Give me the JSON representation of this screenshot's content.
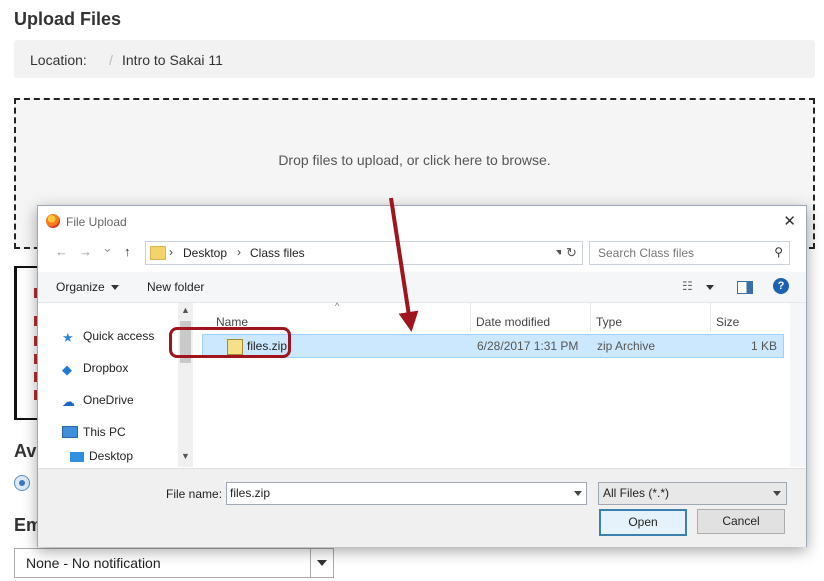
{
  "page": {
    "title": "Upload Files",
    "location_label": "Location:",
    "location_sep": "/",
    "location_value": "Intro to Sakai 11",
    "dropzone_text": "Drop files to upload, or click here to browse.",
    "avail_label": "Ava",
    "email_label": "Em",
    "notification_value": "None - No notification"
  },
  "dialog": {
    "title": "File Upload",
    "close": "✕",
    "nav": {
      "back": "←",
      "forward": "→",
      "down": "⌄",
      "up": "↑"
    },
    "address": {
      "sep1": "›",
      "crumb1": "Desktop",
      "sep2": "›",
      "crumb2": "Class files"
    },
    "refresh": "↻",
    "search_placeholder": "Search Class files",
    "search_icon": "⚲",
    "toolbar": {
      "organize": "Organize",
      "new_folder": "New folder",
      "view_icon": "☷",
      "help": "?"
    },
    "nav_items": [
      {
        "label": "Quick access",
        "icon": "star-icon"
      },
      {
        "label": "Dropbox",
        "icon": "dropbox-icon"
      },
      {
        "label": "OneDrive",
        "icon": "cloud-icon"
      },
      {
        "label": "This PC",
        "icon": "computer-icon"
      },
      {
        "label": "Desktop",
        "icon": "desktop-icon"
      }
    ],
    "scroll": {
      "up": "▲",
      "down": "▼"
    },
    "columns": {
      "name": "Name",
      "date": "Date modified",
      "type": "Type",
      "size": "Size",
      "sort": "^"
    },
    "files": [
      {
        "name": "files.zip",
        "date": "6/28/2017 1:31 PM",
        "type": "zip Archive",
        "size": "1 KB"
      }
    ],
    "filename_label": "File name:",
    "filename_value": "files.zip",
    "filetype_value": "All Files (*.*)",
    "open_button": "Open",
    "cancel_button": "Cancel"
  },
  "colors": {
    "accent_red": "#a0141e",
    "selection": "#cce8ff",
    "help_blue": "#1b62b3"
  }
}
